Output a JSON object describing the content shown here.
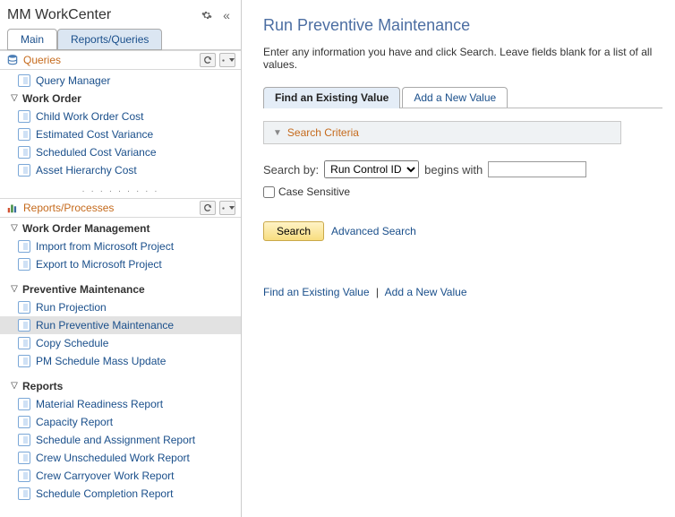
{
  "workcenter": {
    "title": "MM WorkCenter",
    "tabs": [
      {
        "label": "Main",
        "active": false
      },
      {
        "label": "Reports/Queries",
        "active": true
      }
    ]
  },
  "queries_section": {
    "title": "Queries",
    "items": [
      {
        "label": "Query Manager"
      }
    ],
    "groups": [
      {
        "title": "Work Order",
        "items": [
          {
            "label": "Child Work Order Cost"
          },
          {
            "label": "Estimated Cost Variance"
          },
          {
            "label": "Scheduled Cost Variance"
          },
          {
            "label": "Asset Hierarchy Cost"
          }
        ]
      }
    ]
  },
  "reports_section": {
    "title": "Reports/Processes",
    "groups": [
      {
        "title": "Work Order Management",
        "items": [
          {
            "label": "Import from Microsoft Project"
          },
          {
            "label": "Export to Microsoft Project"
          }
        ]
      },
      {
        "title": "Preventive Maintenance",
        "items": [
          {
            "label": "Run Projection"
          },
          {
            "label": "Run Preventive Maintenance",
            "selected": true
          },
          {
            "label": "Copy Schedule"
          },
          {
            "label": "PM Schedule Mass Update"
          }
        ]
      },
      {
        "title": "Reports",
        "items": [
          {
            "label": "Material Readiness Report"
          },
          {
            "label": "Capacity Report"
          },
          {
            "label": "Schedule and Assignment Report"
          },
          {
            "label": "Crew Unscheduled Work Report"
          },
          {
            "label": "Crew Carryover Work Report"
          },
          {
            "label": "Schedule Completion Report"
          }
        ]
      }
    ]
  },
  "page": {
    "title": "Run Preventive Maintenance",
    "instructions": "Enter any information you have and click Search. Leave fields blank for a list of all values.",
    "mode_tabs": {
      "find": "Find an Existing Value",
      "add": "Add a New Value"
    },
    "criteria_header": "Search Criteria",
    "search_by_label": "Search by:",
    "search_by_options": [
      "Run Control ID"
    ],
    "search_by_selected": "Run Control ID",
    "operator_label": "begins with",
    "search_value": "",
    "case_sensitive_label": "Case Sensitive",
    "case_sensitive_checked": false,
    "search_button": "Search",
    "advanced_link": "Advanced Search",
    "bottom_find": "Find an Existing Value",
    "bottom_add": "Add a New Value"
  }
}
